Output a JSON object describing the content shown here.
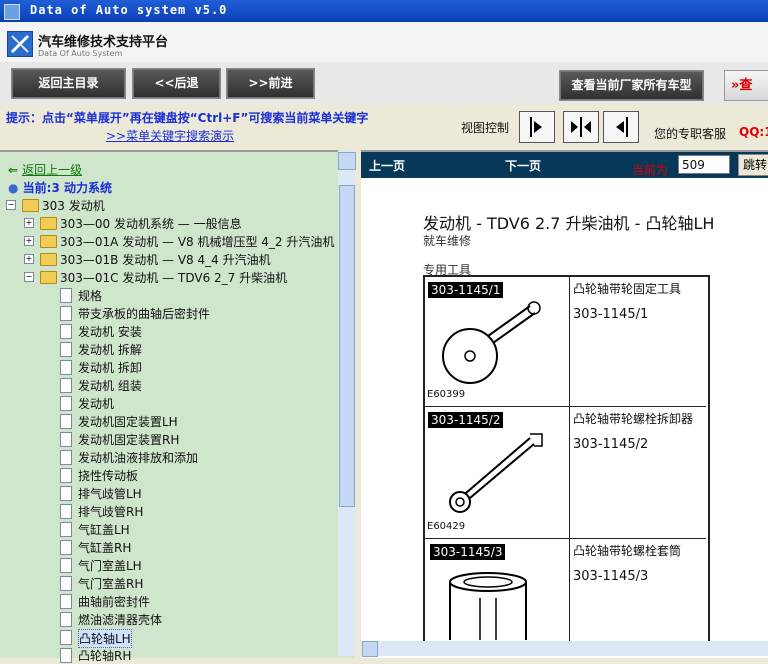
{
  "window": {
    "title": "Data of Auto system v5.0"
  },
  "app": {
    "title": "汽车维修技术支持平台",
    "subtitle": "Data Of Auto System"
  },
  "toolbar": {
    "main_menu": "返回主目录",
    "back": "<<后退",
    "forward": ">>前进",
    "all_models": "查看当前厂家所有车型",
    "partial_red": "查"
  },
  "hints": {
    "line1": "提示：点击“菜单展开”再在键盘按“Ctrl+F”可搜索当前菜单关键字",
    "line2": ">>菜单关键字搜索演示"
  },
  "view_control": {
    "label": "视图控制"
  },
  "service": {
    "label": "您的专职客服",
    "qq": "QQ:1"
  },
  "nav": {
    "up": "返回上一级",
    "current": "当前:3 动力系统"
  },
  "tree": {
    "root": "303 发动机",
    "groups": [
      "303—00 发动机系统 — 一般信息",
      "303—01A 发动机 — V8 机械增压型 4_2 升汽油机",
      "303—01B 发动机 — V8 4_4 升汽油机",
      "303—01C 发动机 — TDV6 2_7 升柴油机"
    ],
    "items": [
      "规格",
      "带支承板的曲轴后密封件",
      "发动机 安装",
      "发动机 拆解",
      "发动机 拆卸",
      "发动机 组装",
      "发动机",
      "发动机固定装置LH",
      "发动机固定装置RH",
      "发动机油液排放和添加",
      "挠性传动板",
      "排气歧管LH",
      "排气歧管RH",
      "气缸盖LH",
      "气缸盖RH",
      "气门室盖LH",
      "气门室盖RH",
      "曲轴前密封件",
      "燃油滤清器壳体",
      "凸轮轴LH",
      "凸轮轴RH"
    ],
    "selected": "凸轮轴LH"
  },
  "doc_nav": {
    "prev": "上一页",
    "next": "下一页",
    "current_label": "当前为",
    "current_page": "509",
    "jump": "跳转"
  },
  "doc": {
    "title": "发动机 - TDV6 2.7 升柴油机 - 凸轮轴LH",
    "subtitle": "就车维修",
    "tools_label": "专用工具",
    "tools": [
      {
        "code": "303-1145/1",
        "fig": "E60399",
        "name": "凸轮轴带轮固定工具",
        "number": "303-1145/1"
      },
      {
        "code": "303-1145/2",
        "fig": "E60429",
        "name": "凸轮轴带轮螺栓拆卸器",
        "number": "303-1145/2"
      },
      {
        "code": "303-1145/3",
        "fig": "",
        "name": "凸轮轴带轮螺栓套筒",
        "number": "303-1145/3"
      }
    ]
  }
}
